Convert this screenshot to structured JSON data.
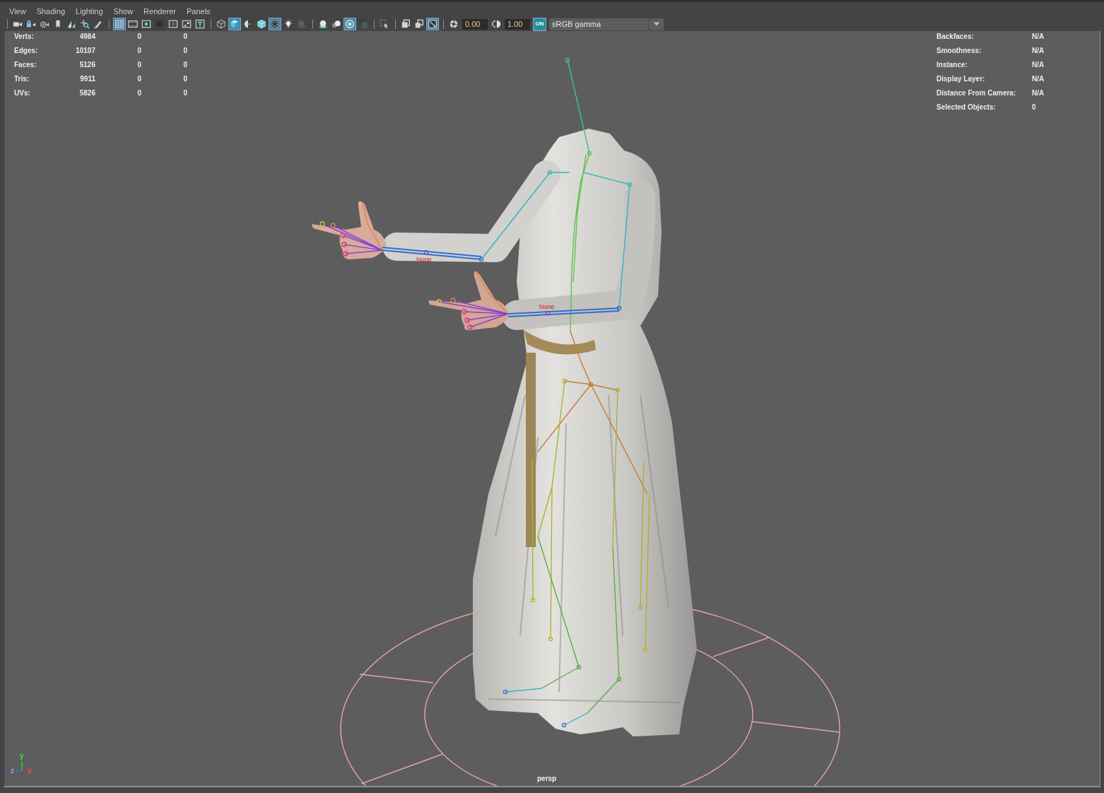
{
  "menu_bar": {
    "items": [
      "View",
      "Shading",
      "Lighting",
      "Show",
      "Renderer",
      "Panels"
    ]
  },
  "toolbar": {
    "groups": [
      [
        {
          "selected": false,
          "disabled": false
        },
        {
          "selected": false,
          "disabled": false
        },
        {
          "selected": false,
          "disabled": false
        },
        {
          "selected": false,
          "disabled": false
        },
        {
          "selected": false,
          "disabled": false
        },
        {
          "selected": false,
          "disabled": false
        },
        {
          "selected": false,
          "disabled": false
        }
      ],
      [
        {
          "selected": true,
          "disabled": false
        },
        {
          "selected": false,
          "disabled": false
        },
        {
          "selected": false,
          "disabled": false
        },
        {
          "selected": false,
          "disabled": false
        },
        {
          "selected": false,
          "disabled": false
        },
        {
          "selected": false,
          "disabled": false
        },
        {
          "selected": false,
          "disabled": false
        }
      ],
      [
        {
          "selected": false,
          "disabled": false
        },
        {
          "selected": true,
          "disabled": false
        },
        {
          "selected": false,
          "disabled": false
        },
        {
          "selected": false,
          "disabled": false
        },
        {
          "selected": true,
          "disabled": false
        },
        {
          "selected": false,
          "disabled": false
        },
        {
          "selected": false,
          "disabled": true
        }
      ],
      [
        {
          "selected": false,
          "disabled": false
        },
        {
          "selected": false,
          "disabled": false
        },
        {
          "selected": true,
          "disabled": false
        },
        {
          "selected": false,
          "disabled": false
        }
      ],
      [
        {
          "selected": false,
          "disabled": false
        }
      ],
      [
        {
          "selected": false,
          "disabled": false
        },
        {
          "selected": false,
          "disabled": false
        },
        {
          "selected": true,
          "disabled": false
        }
      ]
    ],
    "exposure": "0.00",
    "gamma": "1.00",
    "color_management": {
      "label": "ON",
      "on": true
    },
    "view_transform": "sRGB gamma"
  },
  "viewport": {
    "hud_left": [
      {
        "label": "Verts:",
        "values": [
          "4984",
          "0",
          "0"
        ]
      },
      {
        "label": "Edges:",
        "values": [
          "10107",
          "0",
          "0"
        ]
      },
      {
        "label": "Faces:",
        "values": [
          "5126",
          "0",
          "0"
        ]
      },
      {
        "label": "Tris:",
        "values": [
          "9911",
          "0",
          "0"
        ]
      },
      {
        "label": "UVs:",
        "values": [
          "5826",
          "0",
          "0"
        ]
      }
    ],
    "hud_right": [
      {
        "label": "Backfaces:",
        "value": "N/A"
      },
      {
        "label": "Smoothness:",
        "value": "N/A"
      },
      {
        "label": "Instance:",
        "value": "N/A"
      },
      {
        "label": "Display Layer:",
        "value": "N/A"
      },
      {
        "label": "Distance From Camera:",
        "value": "N/A"
      },
      {
        "label": "Selected Objects:",
        "value": "0"
      }
    ],
    "joint_labels": [
      "None",
      "None"
    ],
    "axis_labels": [
      "y",
      "z",
      "x"
    ],
    "camera": "persp"
  }
}
